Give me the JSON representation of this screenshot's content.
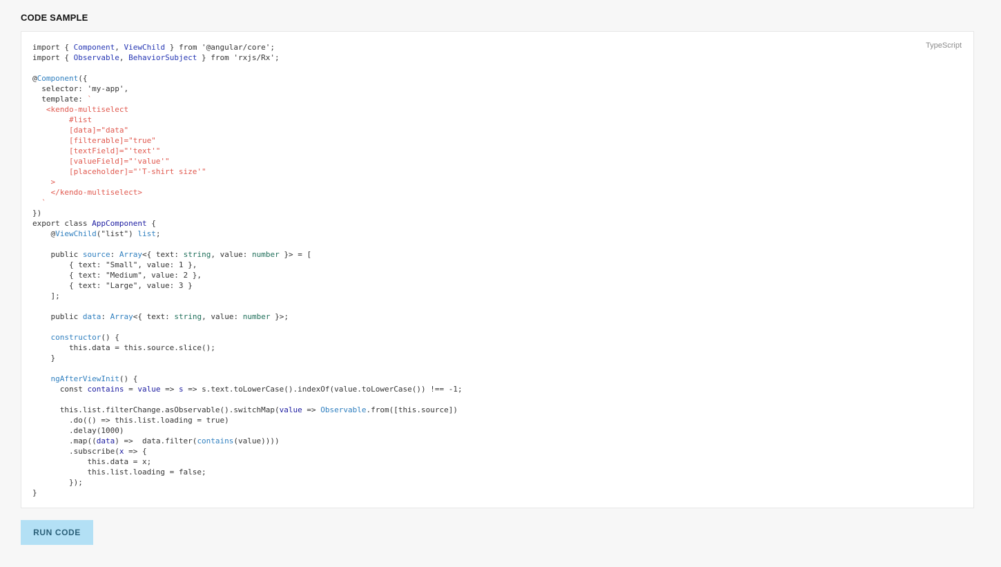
{
  "header": {
    "title": "CODE SAMPLE"
  },
  "code_panel": {
    "language": "TypeScript",
    "lines": [
      [
        {
          "t": "import { ",
          "c": "plain"
        },
        {
          "t": "Component",
          "c": "type"
        },
        {
          "t": ", ",
          "c": "plain"
        },
        {
          "t": "ViewChild",
          "c": "type"
        },
        {
          "t": " } from '@angular/core';",
          "c": "plain"
        }
      ],
      [
        {
          "t": "import { ",
          "c": "plain"
        },
        {
          "t": "Observable",
          "c": "type"
        },
        {
          "t": ", ",
          "c": "plain"
        },
        {
          "t": "BehaviorSubject",
          "c": "type"
        },
        {
          "t": " } from 'rxjs/Rx';",
          "c": "plain"
        }
      ],
      [],
      [
        {
          "t": "@",
          "c": "plain"
        },
        {
          "t": "Component",
          "c": "dec"
        },
        {
          "t": "({",
          "c": "plain"
        }
      ],
      [
        {
          "t": "  selector: 'my-app',",
          "c": "plain"
        }
      ],
      [
        {
          "t": "  template: ",
          "c": "plain"
        },
        {
          "t": "`",
          "c": "tpl"
        }
      ],
      [
        {
          "t": "   <kendo-multiselect",
          "c": "tpl"
        }
      ],
      [
        {
          "t": "        #list",
          "c": "tpl"
        }
      ],
      [
        {
          "t": "        [data]=\"data\"",
          "c": "tpl"
        }
      ],
      [
        {
          "t": "        [filterable]=\"true\"",
          "c": "tpl"
        }
      ],
      [
        {
          "t": "        [textField]=\"'text'\"",
          "c": "tpl"
        }
      ],
      [
        {
          "t": "        [valueField]=\"'value'\"",
          "c": "tpl"
        }
      ],
      [
        {
          "t": "        [placeholder]=\"'T-shirt size'\"",
          "c": "tpl"
        }
      ],
      [
        {
          "t": "    >",
          "c": "tpl"
        }
      ],
      [
        {
          "t": "    </kendo-multiselect>",
          "c": "tpl"
        }
      ],
      [
        {
          "t": "  `",
          "c": "tpl"
        }
      ],
      [
        {
          "t": "})",
          "c": "plain"
        }
      ],
      [
        {
          "t": "export class ",
          "c": "plain"
        },
        {
          "t": "AppComponent",
          "c": "var"
        },
        {
          "t": " {",
          "c": "plain"
        }
      ],
      [
        {
          "t": "    @",
          "c": "plain"
        },
        {
          "t": "ViewChild",
          "c": "dec"
        },
        {
          "t": "(\"list\") ",
          "c": "plain"
        },
        {
          "t": "list",
          "c": "dec"
        },
        {
          "t": ";",
          "c": "plain"
        }
      ],
      [],
      [
        {
          "t": "    public ",
          "c": "plain"
        },
        {
          "t": "source",
          "c": "dec"
        },
        {
          "t": ": ",
          "c": "plain"
        },
        {
          "t": "Array",
          "c": "dec"
        },
        {
          "t": "<{ text: ",
          "c": "plain"
        },
        {
          "t": "string",
          "c": "prim"
        },
        {
          "t": ", value: ",
          "c": "plain"
        },
        {
          "t": "number",
          "c": "prim"
        },
        {
          "t": " }> = [",
          "c": "plain"
        }
      ],
      [
        {
          "t": "        { text: \"Small\", value: 1 },",
          "c": "plain"
        }
      ],
      [
        {
          "t": "        { text: \"Medium\", value: 2 },",
          "c": "plain"
        }
      ],
      [
        {
          "t": "        { text: \"Large\", value: 3 }",
          "c": "plain"
        }
      ],
      [
        {
          "t": "    ];",
          "c": "plain"
        }
      ],
      [],
      [
        {
          "t": "    public ",
          "c": "plain"
        },
        {
          "t": "data",
          "c": "dec"
        },
        {
          "t": ": ",
          "c": "plain"
        },
        {
          "t": "Array",
          "c": "dec"
        },
        {
          "t": "<{ text: ",
          "c": "plain"
        },
        {
          "t": "string",
          "c": "prim"
        },
        {
          "t": ", value: ",
          "c": "plain"
        },
        {
          "t": "number",
          "c": "prim"
        },
        {
          "t": " }>;",
          "c": "plain"
        }
      ],
      [],
      [
        {
          "t": "    ",
          "c": "plain"
        },
        {
          "t": "constructor",
          "c": "dec"
        },
        {
          "t": "() {",
          "c": "plain"
        }
      ],
      [
        {
          "t": "        this.data = this.source.slice();",
          "c": "plain"
        }
      ],
      [
        {
          "t": "    }",
          "c": "plain"
        }
      ],
      [],
      [
        {
          "t": "    ",
          "c": "plain"
        },
        {
          "t": "ngAfterViewInit",
          "c": "dec"
        },
        {
          "t": "() {",
          "c": "plain"
        }
      ],
      [
        {
          "t": "      const ",
          "c": "plain"
        },
        {
          "t": "contains",
          "c": "var"
        },
        {
          "t": " = ",
          "c": "plain"
        },
        {
          "t": "value",
          "c": "var"
        },
        {
          "t": " => ",
          "c": "plain"
        },
        {
          "t": "s",
          "c": "var"
        },
        {
          "t": " => s.text.toLowerCase().indexOf(value.toLowerCase()) !== -1;",
          "c": "plain"
        }
      ],
      [],
      [
        {
          "t": "      this.list.filterChange.asObservable().switchMap(",
          "c": "plain"
        },
        {
          "t": "value",
          "c": "var"
        },
        {
          "t": " => ",
          "c": "plain"
        },
        {
          "t": "Observable",
          "c": "dec"
        },
        {
          "t": ".from([this.source])",
          "c": "plain"
        }
      ],
      [
        {
          "t": "        .do(() => this.list.loading = true)",
          "c": "plain"
        }
      ],
      [
        {
          "t": "        .delay(1000)",
          "c": "plain"
        }
      ],
      [
        {
          "t": "        .map((",
          "c": "plain"
        },
        {
          "t": "data",
          "c": "var"
        },
        {
          "t": ") =>  data.filter(",
          "c": "plain"
        },
        {
          "t": "contains",
          "c": "dec"
        },
        {
          "t": "(value))))",
          "c": "plain"
        }
      ],
      [
        {
          "t": "        .subscribe(",
          "c": "plain"
        },
        {
          "t": "x",
          "c": "var"
        },
        {
          "t": " => {",
          "c": "plain"
        }
      ],
      [
        {
          "t": "            this.data = x;",
          "c": "plain"
        }
      ],
      [
        {
          "t": "            this.list.loading = false;",
          "c": "plain"
        }
      ],
      [
        {
          "t": "        });",
          "c": "plain"
        }
      ],
      [
        {
          "t": "}",
          "c": "plain"
        }
      ]
    ]
  },
  "actions": {
    "run_label": "RUN CODE"
  },
  "colors": {
    "background": "#f7f7f7",
    "panel": "#ffffff",
    "template_string": "#e0584e",
    "identifier_blue": "#2f7fbf",
    "type_blue": "#2536b3",
    "primitive_green": "#1f6f5a",
    "button_bg": "#b3e0f5"
  }
}
